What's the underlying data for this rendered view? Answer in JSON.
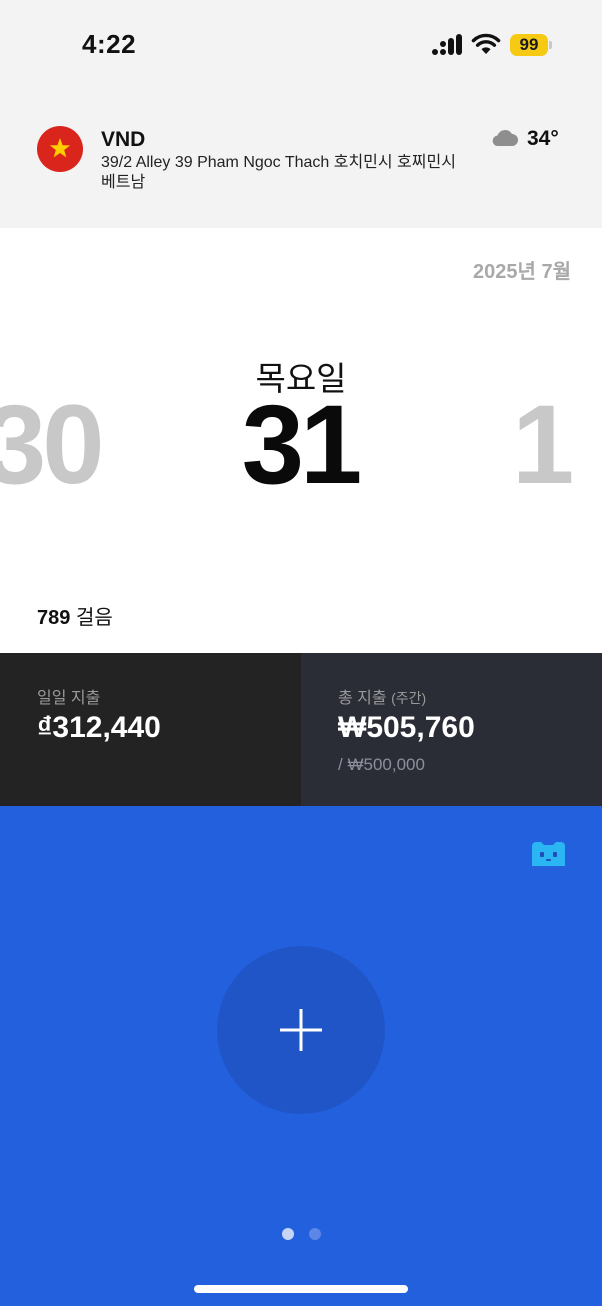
{
  "status_bar": {
    "time": "4:22",
    "battery_level": "99",
    "battery_color": "#f6c913"
  },
  "header": {
    "currency": "VND",
    "flag_icon": "vietnam-flag",
    "address": "39/2 Alley 39 Pham Ngoc Thach 호치민시 호찌민시 베트남",
    "weather_icon": "cloud-icon",
    "temperature": "34°"
  },
  "calendar": {
    "month_label": "2025년 7월",
    "weekday": "목요일",
    "prev_day": "30",
    "current_day": "31",
    "next_day": "1"
  },
  "steps": {
    "count": "789",
    "unit": "걸음"
  },
  "spending": {
    "daily": {
      "label": "일일 지출",
      "amount": "₫312,440"
    },
    "weekly": {
      "label": "총 지출",
      "label_suffix": "(주간)",
      "amount": "₩505,760",
      "budget": "/ ₩500,000"
    }
  },
  "actions": {
    "add_icon": "plus-icon",
    "assistant_icon": "bot-icon"
  },
  "pager": {
    "pages": 2,
    "active_index": 0
  },
  "colors": {
    "accent_blue": "#2260dd",
    "daily_card_bg": "#232323",
    "weekly_card_bg": "#2a2c36"
  }
}
